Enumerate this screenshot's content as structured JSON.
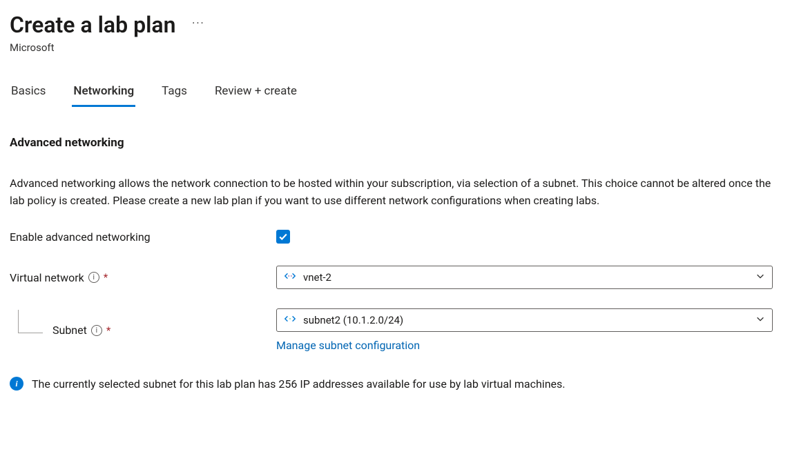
{
  "header": {
    "title": "Create a lab plan",
    "subtitle": "Microsoft"
  },
  "tabs": [
    {
      "label": "Basics",
      "active": false
    },
    {
      "label": "Networking",
      "active": true
    },
    {
      "label": "Tags",
      "active": false
    },
    {
      "label": "Review + create",
      "active": false
    }
  ],
  "section": {
    "title": "Advanced networking",
    "description": "Advanced networking allows the network connection to be hosted within your subscription, via selection of a subnet. This choice cannot be altered once the lab policy is created. Please create a new lab plan if you want to use different network configurations when creating labs."
  },
  "form": {
    "enable_label": "Enable advanced networking",
    "enable_checked": true,
    "vnet_label": "Virtual network",
    "vnet_value": "vnet-2",
    "subnet_label": "Subnet",
    "subnet_value": "subnet2 (10.1.2.0/24)",
    "manage_link": "Manage subnet configuration"
  },
  "info_message": "The currently selected subnet for this lab plan has 256 IP addresses available for use by lab virtual machines."
}
